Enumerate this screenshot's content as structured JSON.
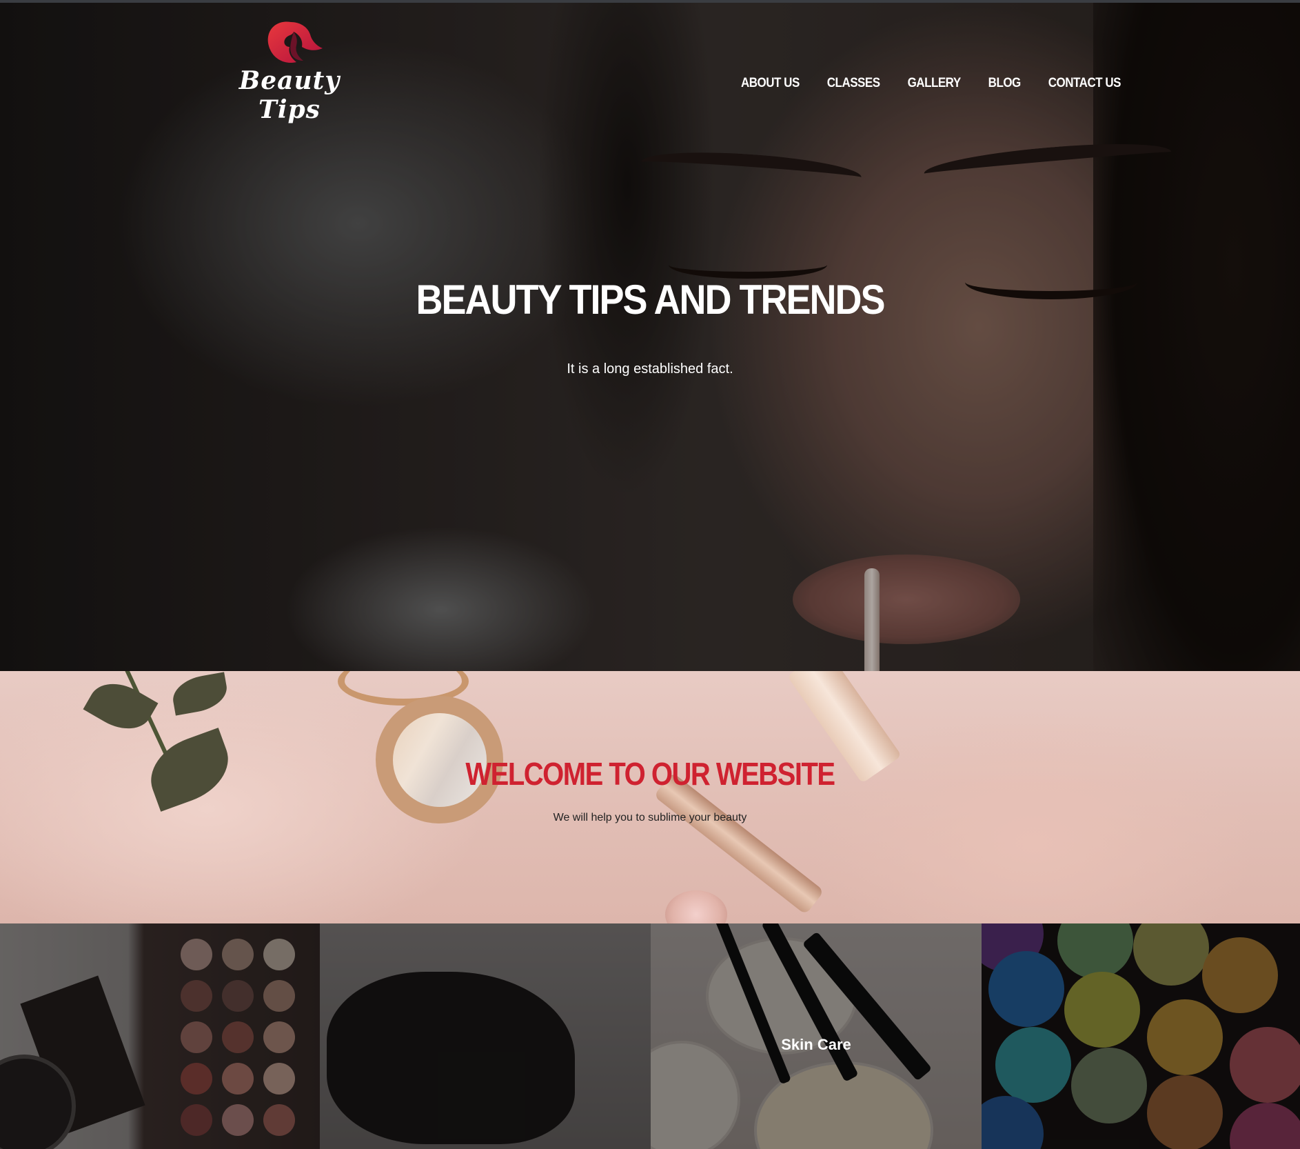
{
  "brand": {
    "logo_text": "Beauty Tips",
    "accent": "#cf2230"
  },
  "nav": {
    "items": [
      {
        "label": "ABOUT US"
      },
      {
        "label": "CLASSES"
      },
      {
        "label": "GALLERY"
      },
      {
        "label": "BLOG"
      },
      {
        "label": "CONTACT US"
      }
    ]
  },
  "hero": {
    "title": "BEAUTY TIPS AND TRENDS",
    "subtitle": "It is a long established fact."
  },
  "welcome": {
    "title": "WELCOME TO OUR WEBSITE",
    "subtitle": "We will help you to sublime your beauty"
  },
  "categories": [
    {
      "label": ""
    },
    {
      "label": ""
    },
    {
      "label": "Skin Care"
    },
    {
      "label": ""
    }
  ]
}
